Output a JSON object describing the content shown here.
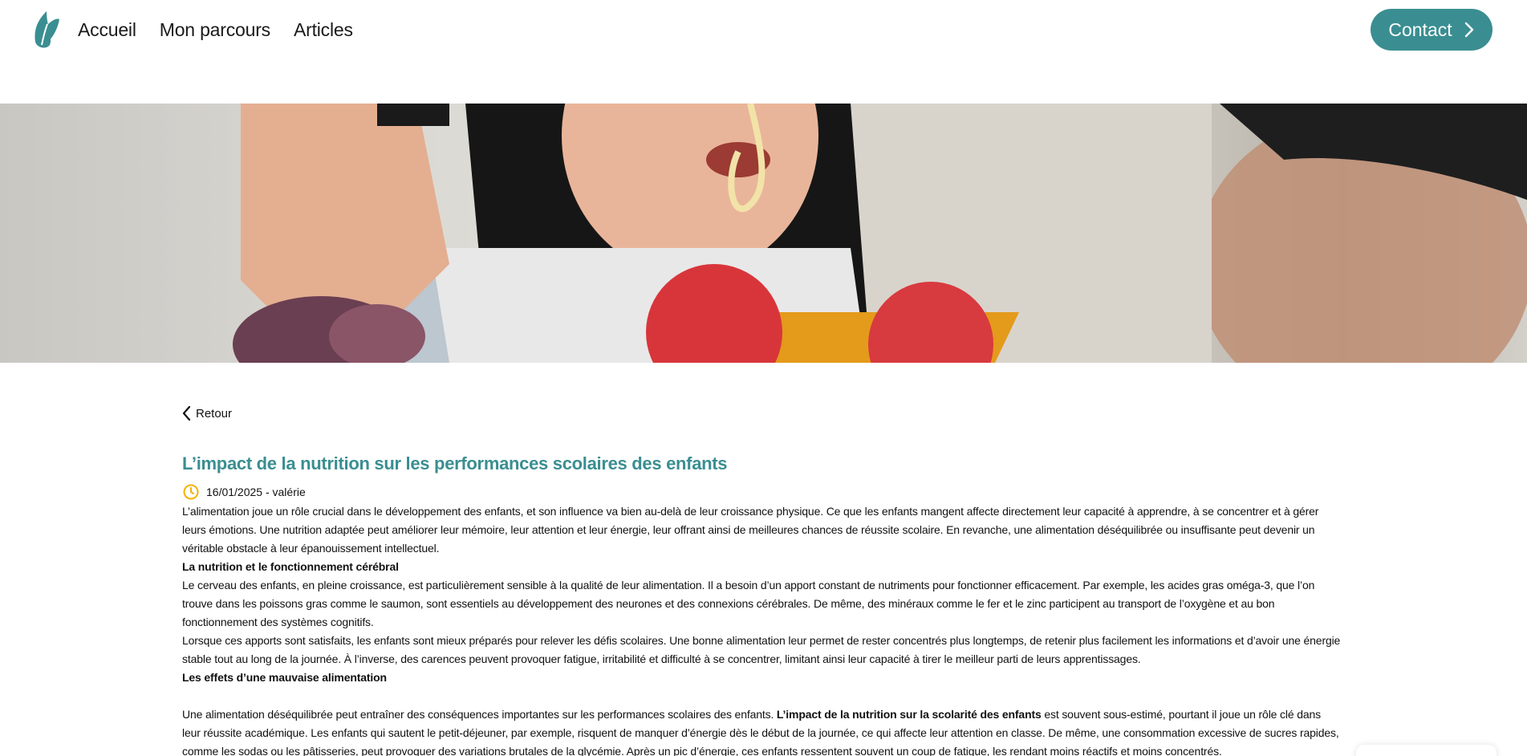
{
  "header": {
    "nav": [
      "Accueil",
      "Mon parcours",
      "Articles"
    ],
    "contact_label": "Contact"
  },
  "colors": {
    "accent": "#3a8e91",
    "clock": "#f2b400"
  },
  "icons": {
    "logo": "leaf-logo-icon",
    "contact": "chevron-right-icon",
    "back": "chevron-left-icon",
    "date": "clock-icon"
  },
  "article": {
    "back_label": "Retour",
    "title": "L’impact de la nutrition sur les performances scolaires des enfants",
    "meta": "16/01/2025 - valérie",
    "intro": "L’alimentation joue un rôle crucial dans le développement des enfants, et son influence va bien au-delà de leur croissance physique. Ce que les enfants mangent affecte directement leur capacité à apprendre, à se concentrer et à gérer leurs émotions. Une nutrition adaptée peut améliorer leur mémoire, leur attention et leur énergie, leur offrant ainsi de meilleures chances de réussite scolaire. En revanche, une alimentation déséquilibrée ou insuffisante peut devenir un véritable obstacle à leur épanouissement intellectuel.",
    "h1": "La nutrition et le fonctionnement cérébral",
    "p1": "Le cerveau des enfants, en pleine croissance, est particulièrement sensible à la qualité de leur alimentation. Il a besoin d’un apport constant de nutriments pour fonctionner efficacement. Par exemple, les acides gras oméga-3, que l’on trouve dans les poissons gras comme le saumon, sont essentiels au développement des neurones et des connexions cérébrales. De même, des minéraux comme le fer et le zinc participent au transport de l’oxygène et au bon fonctionnement des systèmes cognitifs.",
    "p2": "Lorsque ces apports sont satisfaits, les enfants sont mieux préparés pour relever les défis scolaires. Une bonne alimentation leur permet de rester concentrés plus longtemps, de retenir plus facilement les informations et d’avoir une énergie stable tout au long de la journée. À l’inverse, des carences peuvent provoquer fatigue, irritabilité et difficulté à se concentrer, limitant ainsi leur capacité à tirer le meilleur parti de leurs apprentissages.",
    "h2": "Les effets d’une mauvaise alimentation",
    "p3_a": "Une alimentation déséquilibrée peut entraîner des conséquences importantes sur les performances scolaires des enfants. ",
    "p3_b": "L’impact de la nutrition sur la scolarité des enfants",
    "p3_c": " est souvent sous-estimé, pourtant il joue un rôle clé dans leur réussite académique. Les enfants qui sautent le petit-déjeuner, par exemple, risquent de manquer d’énergie dès le début de la journée, ce qui affecte leur attention en classe. De même, une consommation excessive de sucres rapides, comme les sodas ou les pâtisseries, peut provoquer des variations brutales de la glycémie. Après un pic d’énergie, ces enfants ressentent souvent un coup de fatigue, les rendant moins réactifs et moins concentrés."
  }
}
